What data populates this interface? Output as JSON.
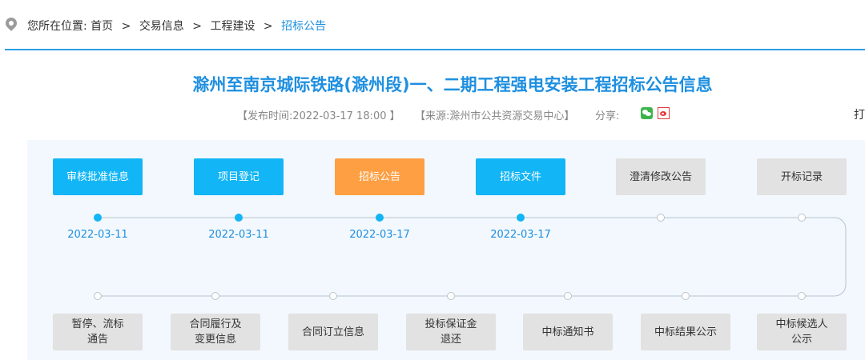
{
  "breadcrumb": {
    "prefix": "您所在位置:",
    "items": [
      "首页",
      "交易信息",
      "工程建设",
      "招标公告"
    ],
    "separator": ">"
  },
  "page": {
    "title": "滁州至南京城际铁路(滁州段)一、二期工程强电安装工程招标公告信息",
    "publish_time": "【发布时间:2022-03-17 18:00 】",
    "source": "【来源:滁州市公共资源交易中心】",
    "share_label": "分享:",
    "print_label": "打"
  },
  "flow": {
    "top": [
      {
        "label": "审核批准信息",
        "date": "2022-03-11",
        "state": "done"
      },
      {
        "label": "项目登记",
        "date": "2022-03-11",
        "state": "done"
      },
      {
        "label": "招标公告",
        "date": "2022-03-17",
        "state": "current"
      },
      {
        "label": "招标文件",
        "date": "2022-03-17",
        "state": "done"
      },
      {
        "label": "澄清修改公告",
        "date": "",
        "state": "pending"
      },
      {
        "label": "开标记录",
        "date": "",
        "state": "pending"
      }
    ],
    "bottom": [
      {
        "label": "暂停、流标\n通告",
        "state": "pending"
      },
      {
        "label": "合同履行及\n变更信息",
        "state": "pending"
      },
      {
        "label": "合同订立信息",
        "state": "pending"
      },
      {
        "label": "投标保证金\n退还",
        "state": "pending"
      },
      {
        "label": "中标通知书",
        "state": "pending"
      },
      {
        "label": "中标结果公示",
        "state": "pending"
      },
      {
        "label": "中标候选人\n公示",
        "state": "pending"
      }
    ]
  },
  "colors": {
    "accent": "#1e8fe0",
    "done": "#12b5f5",
    "current": "#fe9f43",
    "pending": "#e2e2e2"
  }
}
